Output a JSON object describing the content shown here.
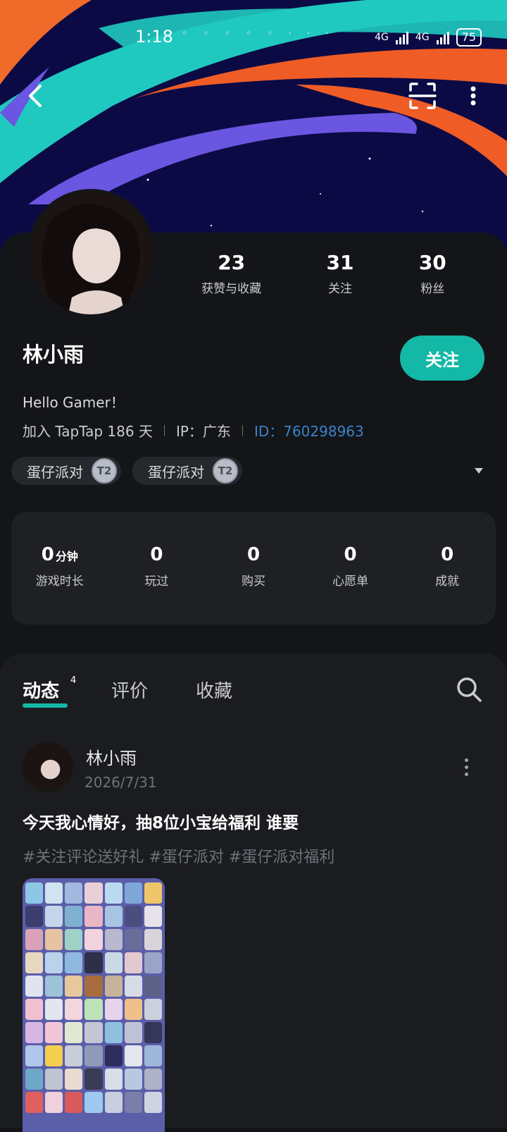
{
  "status_bar": {
    "time": "1:18",
    "network_1": "4G",
    "network_2": "4G",
    "battery": "75"
  },
  "top_bar": {
    "back_icon": "chevron-left-icon",
    "scan_icon": "scan-icon",
    "more_icon": "more-vertical-icon"
  },
  "profile": {
    "name": "林小雨",
    "bio": "Hello Gamer！",
    "joined": "加入 TapTap 186 天",
    "ip": "IP：广东",
    "id": "ID：760298963",
    "follow_label": "关注",
    "stats": [
      {
        "value": "23",
        "label": "获赞与收藏"
      },
      {
        "value": "31",
        "label": "关注"
      },
      {
        "value": "30",
        "label": "粉丝"
      }
    ],
    "game_tags": [
      {
        "name": "蛋仔派对",
        "badge": "T2"
      },
      {
        "name": "蛋仔派对",
        "badge": "T2"
      }
    ]
  },
  "game_stats": [
    {
      "value": "0",
      "unit": "分钟",
      "label": "游戏时长"
    },
    {
      "value": "0",
      "unit": "",
      "label": "玩过"
    },
    {
      "value": "0",
      "unit": "",
      "label": "购买"
    },
    {
      "value": "0",
      "unit": "",
      "label": "心愿单"
    },
    {
      "value": "0",
      "unit": "",
      "label": "成就"
    }
  ],
  "tabs": {
    "active": "动态",
    "active_count": "4",
    "review": "评价",
    "collect": "收藏"
  },
  "post": {
    "author": "林小雨",
    "date": "2026/7/31",
    "title": "今天我心情好，抽8位小宝给福利 谁要",
    "tags": "#关注评论送好礼 #蛋仔派对 #蛋仔派对福利"
  },
  "colors": {
    "accent": "#14b8a6",
    "id_link": "#3b82c8",
    "background": "#141518",
    "hero_bg": "#0b0a45"
  }
}
